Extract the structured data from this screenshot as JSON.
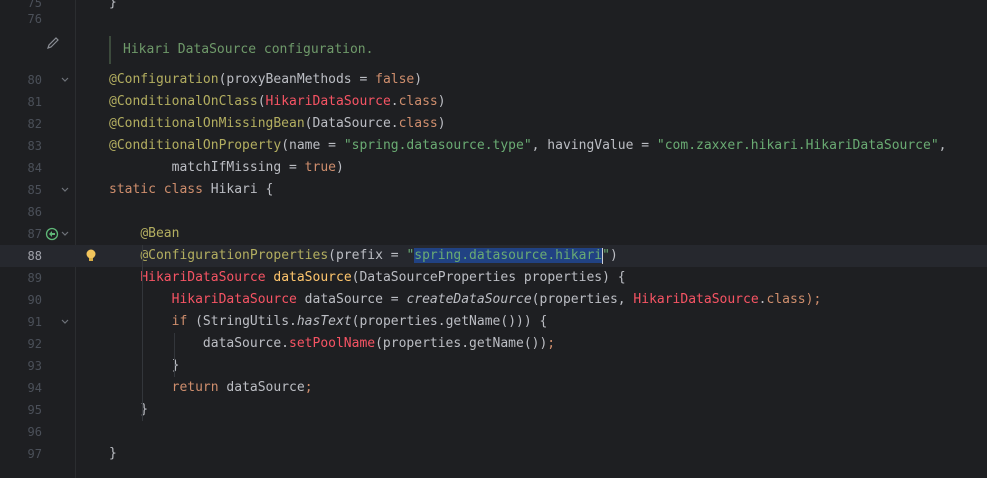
{
  "editor": {
    "doc_comment": "Hikari DataSource configuration.",
    "lines": [
      {
        "num": "75",
        "parts": [
          {
            "t": "}",
            "c": "cls"
          }
        ]
      },
      {
        "num": "76",
        "parts": []
      },
      {
        "num": "80",
        "parts": [
          {
            "t": "@Configuration",
            "c": "ann"
          },
          {
            "t": "(proxyBeanMethods = ",
            "c": "cls"
          },
          {
            "t": "false",
            "c": "kw"
          },
          {
            "t": ")",
            "c": "cls"
          }
        ]
      },
      {
        "num": "81",
        "parts": [
          {
            "t": "@ConditionalOnClass",
            "c": "ann"
          },
          {
            "t": "(",
            "c": "cls"
          },
          {
            "t": "HikariDataSource",
            "c": "red"
          },
          {
            "t": ".",
            "c": "cls"
          },
          {
            "t": "class",
            "c": "kw"
          },
          {
            "t": ")",
            "c": "cls"
          }
        ]
      },
      {
        "num": "82",
        "parts": [
          {
            "t": "@ConditionalOnMissingBean",
            "c": "ann"
          },
          {
            "t": "(DataSource.",
            "c": "cls"
          },
          {
            "t": "class",
            "c": "kw"
          },
          {
            "t": ")",
            "c": "cls"
          }
        ]
      },
      {
        "num": "83",
        "parts": [
          {
            "t": "@ConditionalOnProperty",
            "c": "ann"
          },
          {
            "t": "(name = ",
            "c": "cls"
          },
          {
            "t": "\"spring.datasource.type\"",
            "c": "str"
          },
          {
            "t": ", havingValue = ",
            "c": "cls"
          },
          {
            "t": "\"com.zaxxer.hikari.HikariDataSource\"",
            "c": "str"
          },
          {
            "t": ",",
            "c": "cls"
          }
        ]
      },
      {
        "num": "84",
        "parts": [
          {
            "t": "        matchIfMissing = ",
            "c": "cls"
          },
          {
            "t": "true",
            "c": "kw"
          },
          {
            "t": ")",
            "c": "cls"
          }
        ]
      },
      {
        "num": "85",
        "parts": [
          {
            "t": "static class ",
            "c": "kw"
          },
          {
            "t": "Hikari {",
            "c": "cls"
          }
        ]
      },
      {
        "num": "86",
        "parts": []
      },
      {
        "num": "87",
        "parts": [
          {
            "t": "    ",
            "c": "cls"
          },
          {
            "t": "@Bean",
            "c": "ann"
          }
        ]
      },
      {
        "num": "88",
        "parts": [
          {
            "t": "    ",
            "c": "cls"
          },
          {
            "t": "@ConfigurationProperties",
            "c": "ann"
          },
          {
            "t": "(prefix = ",
            "c": "cls"
          },
          {
            "t": "\"",
            "c": "str"
          },
          {
            "t": "spring.datasource.hikari",
            "c": "str sel"
          },
          {
            "t": "|",
            "c": "caret"
          },
          {
            "t": "\"",
            "c": "str"
          },
          {
            "t": ")",
            "c": "cls"
          }
        ]
      },
      {
        "num": "89",
        "parts": [
          {
            "t": "    ",
            "c": "cls"
          },
          {
            "t": "HikariDataSource ",
            "c": "red"
          },
          {
            "t": "dataSource",
            "c": "fn"
          },
          {
            "t": "(DataSourceProperties properties) {",
            "c": "cls"
          }
        ]
      },
      {
        "num": "90",
        "parts": [
          {
            "t": "        ",
            "c": "cls"
          },
          {
            "t": "HikariDataSource",
            "c": "red"
          },
          {
            "t": " dataSource = ",
            "c": "cls"
          },
          {
            "t": "createDataSource",
            "c": "ital"
          },
          {
            "t": "(properties, ",
            "c": "cls"
          },
          {
            "t": "HikariDataSource",
            "c": "red"
          },
          {
            "t": ".",
            "c": "cls"
          },
          {
            "t": "class",
            "c": "kw"
          },
          {
            "t": ");",
            "c": "kw"
          }
        ]
      },
      {
        "num": "91",
        "parts": [
          {
            "t": "        ",
            "c": "cls"
          },
          {
            "t": "if ",
            "c": "kw"
          },
          {
            "t": "(StringUtils.",
            "c": "cls"
          },
          {
            "t": "hasText",
            "c": "ital"
          },
          {
            "t": "(properties.getName())) {",
            "c": "cls"
          }
        ]
      },
      {
        "num": "92",
        "parts": [
          {
            "t": "            dataSource.",
            "c": "cls"
          },
          {
            "t": "setPoolName",
            "c": "red"
          },
          {
            "t": "(properties.getName())",
            "c": "cls"
          },
          {
            "t": ";",
            "c": "kw"
          }
        ]
      },
      {
        "num": "93",
        "parts": [
          {
            "t": "        }",
            "c": "cls"
          }
        ]
      },
      {
        "num": "94",
        "parts": [
          {
            "t": "        ",
            "c": "cls"
          },
          {
            "t": "return ",
            "c": "kw"
          },
          {
            "t": "dataSource",
            "c": "cls"
          },
          {
            "t": ";",
            "c": "kw"
          }
        ]
      },
      {
        "num": "95",
        "parts": [
          {
            "t": "    }",
            "c": "cls"
          }
        ]
      },
      {
        "num": "96",
        "parts": []
      },
      {
        "num": "97",
        "parts": [
          {
            "t": "}",
            "c": "cls"
          }
        ]
      }
    ]
  },
  "icons": {
    "edit": "pencil-icon",
    "bean": "bean-gutter-icon",
    "intention": "lightbulb-icon",
    "fold": "fold-chevron-icon"
  }
}
